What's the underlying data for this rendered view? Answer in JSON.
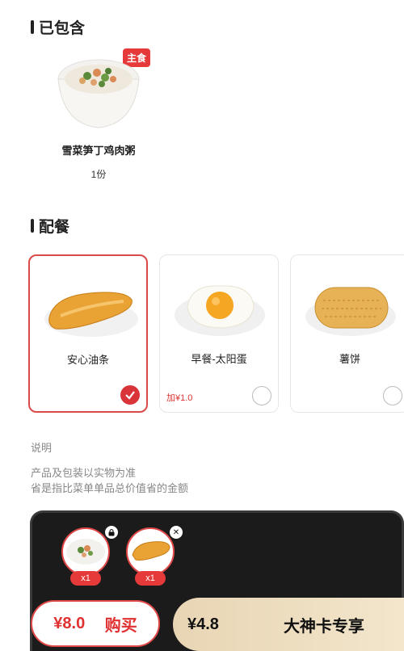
{
  "included": {
    "title": "已包含",
    "item": {
      "name": "雪菜笋丁鸡肉粥",
      "qty": "1份",
      "tag": "主食"
    }
  },
  "sides": {
    "title": "配餐",
    "items": [
      {
        "name": "安心油条",
        "price": "",
        "selected": true
      },
      {
        "name": "早餐-太阳蛋",
        "price": "加¥1.0",
        "selected": false
      },
      {
        "name": "薯饼",
        "price": "",
        "selected": false
      }
    ]
  },
  "notes": {
    "heading": "说明",
    "line1": "产品及包装以实物为准",
    "line2": "省是指比菜单单品总价值省的金额"
  },
  "cart": {
    "items": [
      {
        "qty": "x1",
        "icon": "lock-icon"
      },
      {
        "qty": "x1",
        "icon": "close-icon"
      }
    ],
    "buy_price": "¥8.0",
    "buy_label": "购买",
    "vip_price": "¥4.8",
    "vip_label": "大神卡专享"
  },
  "colors": {
    "accent": "#e63a3a",
    "vip_gold": "#e8d5b4",
    "panel": "#1b1b1b"
  }
}
